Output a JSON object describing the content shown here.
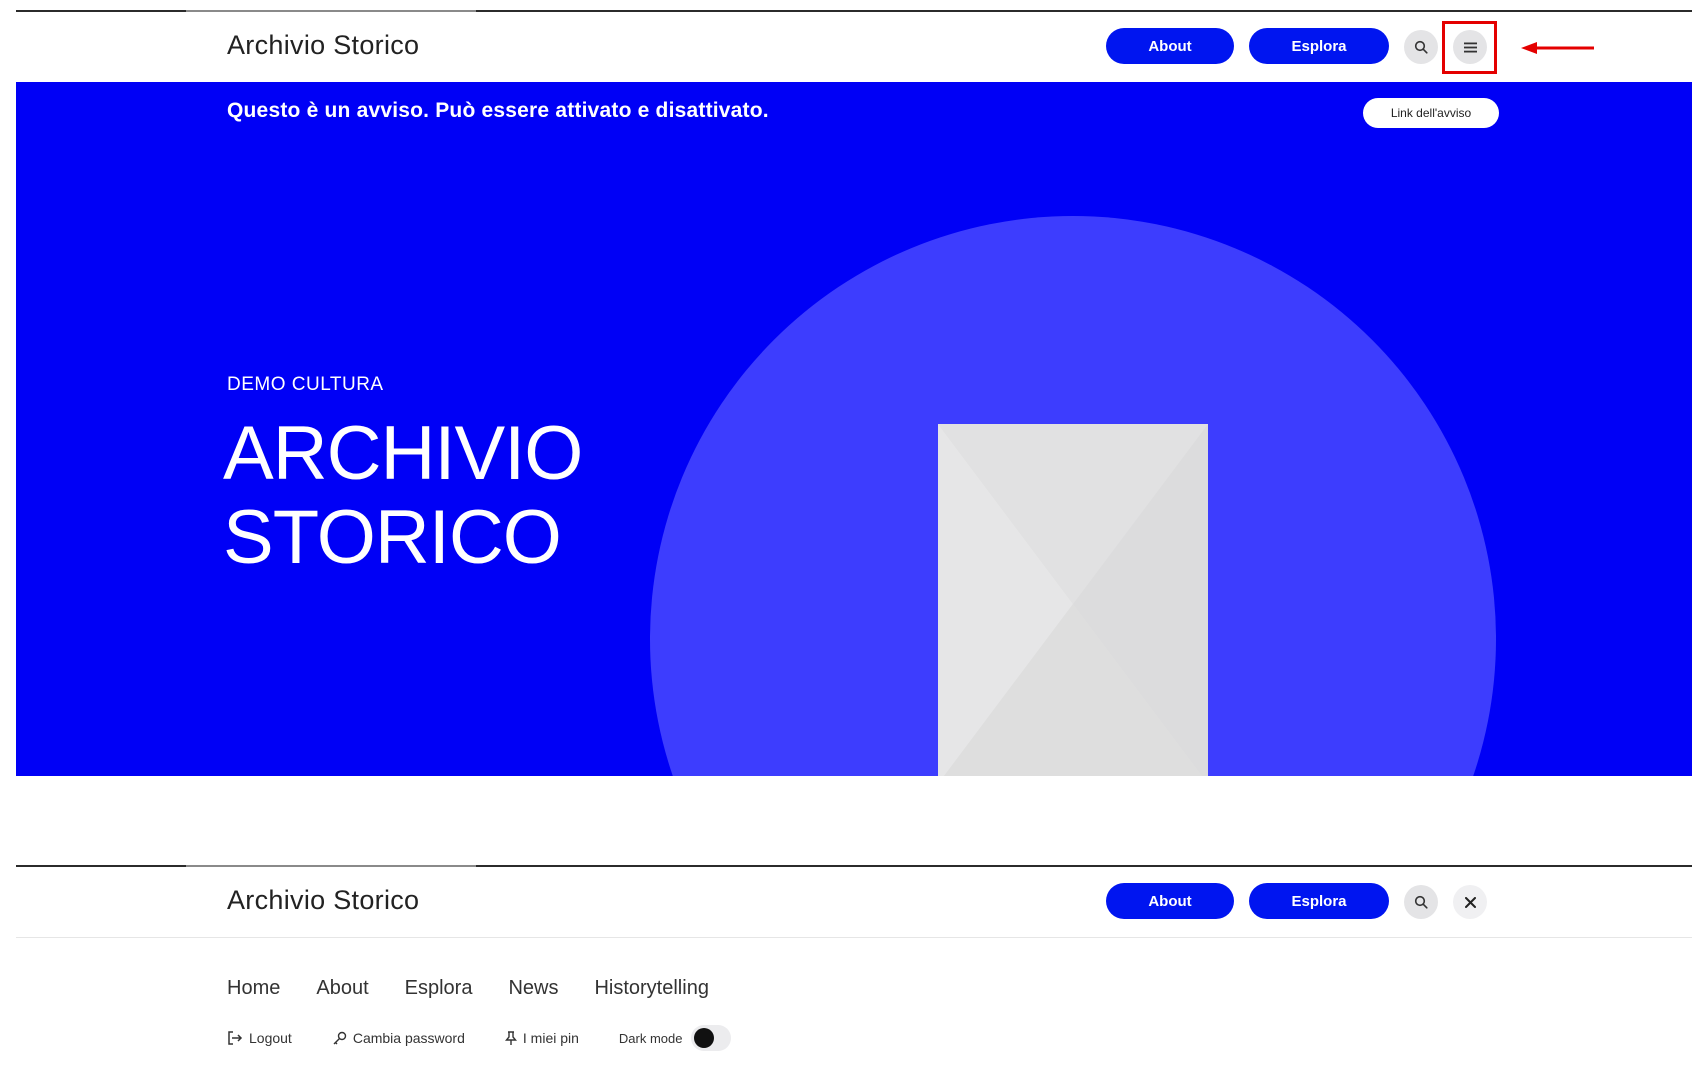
{
  "colors": {
    "primary_blue": "#0015f0",
    "hero_bg": "#0000f6",
    "hero_circle": "#3d3dfe",
    "highlight_red": "#e40000",
    "placeholder_gray": "#dfdfe0"
  },
  "screen1": {
    "header": {
      "title": "Archivio Storico",
      "about_label": "About",
      "explore_label": "Esplora",
      "search_icon": "search-icon",
      "menu_icon": "hamburger-menu-icon"
    },
    "notice": {
      "text": "Questo è un avviso. Può essere attivato e disattivato.",
      "link_label": "Link dell'avviso"
    },
    "hero": {
      "eyebrow": "DEMO CULTURA",
      "title_line1": "ARCHIVIO",
      "title_line2": "STORICO",
      "image_icon": "image-placeholder-icon"
    }
  },
  "screen2": {
    "header": {
      "title": "Archivio Storico",
      "about_label": "About",
      "explore_label": "Esplora",
      "search_icon": "search-icon",
      "close_icon": "close-icon"
    },
    "nav": [
      "Home",
      "About",
      "Esplora",
      "News",
      "Historytelling"
    ],
    "utilities": {
      "logout_label": "Logout",
      "change_password_label": "Cambia password",
      "my_pins_label": "I miei pin",
      "dark_mode_label": "Dark mode",
      "dark_mode_on": false
    }
  }
}
